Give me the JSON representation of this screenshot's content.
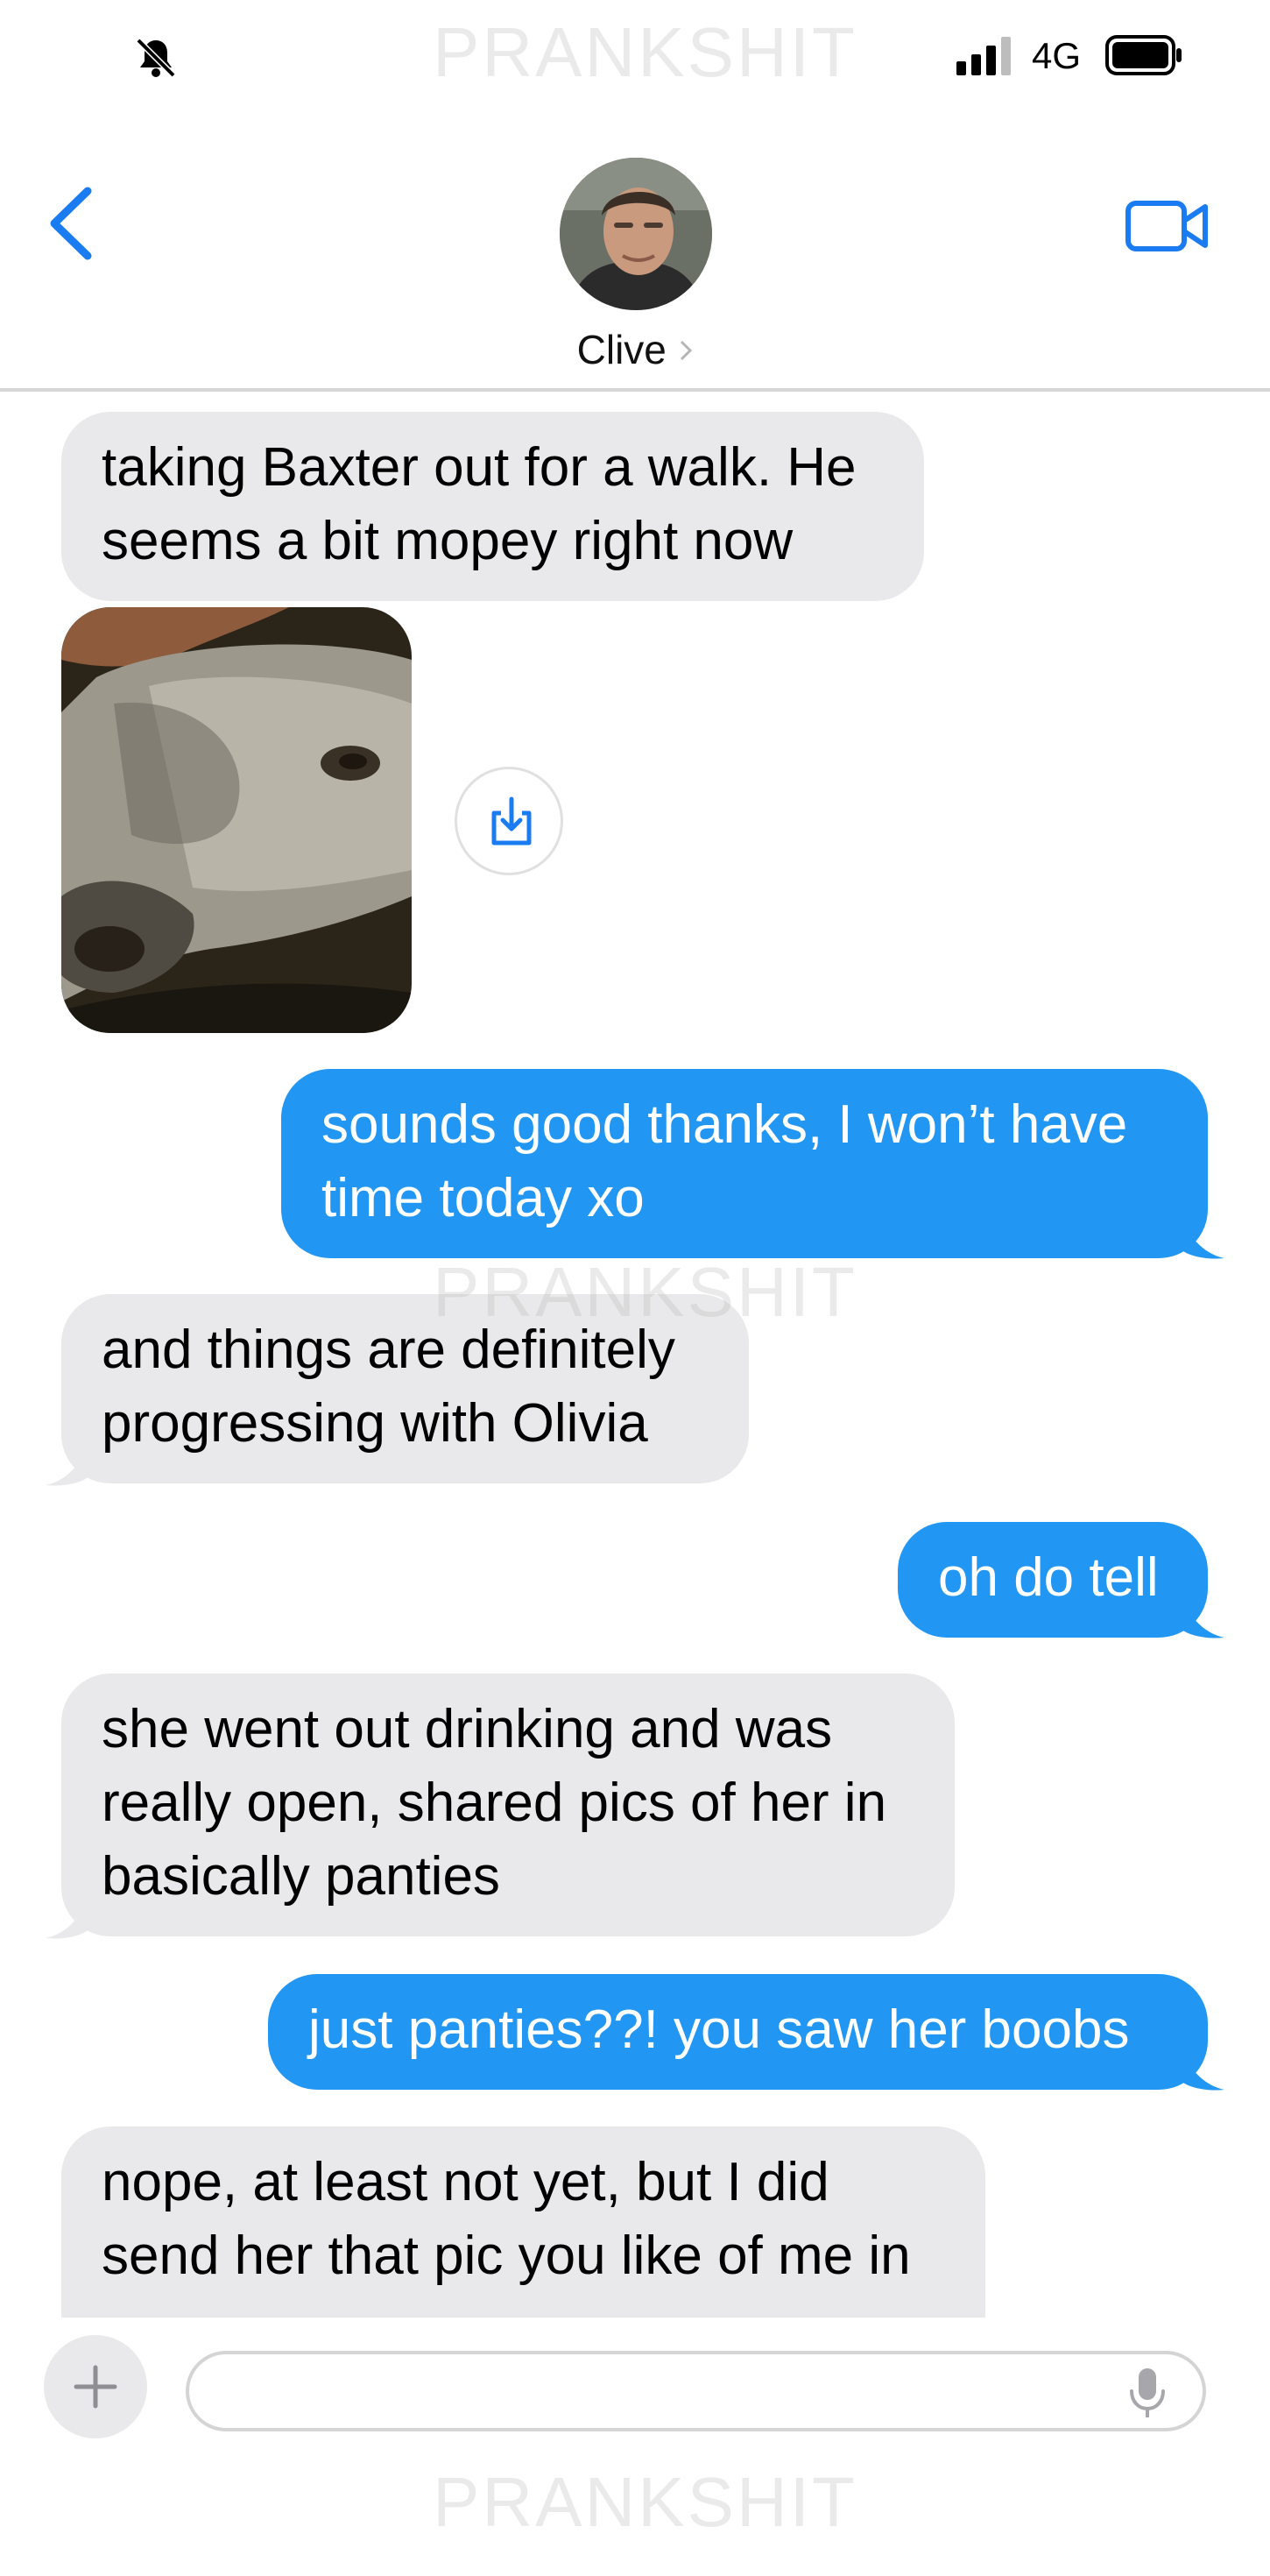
{
  "status_bar": {
    "network": "4G",
    "mute_icon": "bell-slash-icon",
    "signal_icon": "signal-bars-icon",
    "battery_icon": "battery-full-icon"
  },
  "watermark": "PRANKSHIT",
  "header": {
    "back_icon": "chevron-left-icon",
    "contact_name": "Clive",
    "video_icon": "video-camera-icon"
  },
  "messages": [
    {
      "from": "contact",
      "text": "taking Baxter out for a walk. He\nseems a bit mopey right now"
    },
    {
      "from": "contact",
      "type": "photo",
      "subject": "dog",
      "action_icon": "save-download-icon"
    },
    {
      "from": "me",
      "text": "sounds good thanks, I won’t have\ntime today xo"
    },
    {
      "from": "contact",
      "text": "and things are definitely\nprogressing with Olivia"
    },
    {
      "from": "me",
      "text": "oh do tell"
    },
    {
      "from": "contact",
      "text": "she went out drinking and was\nreally open, shared pics of her in\nbasically panties"
    },
    {
      "from": "me",
      "text": "just panties??! you saw her boobs"
    },
    {
      "from": "contact",
      "text": "nope, at least not yet, but I did\nsend her that pic you like of me in"
    }
  ],
  "composer": {
    "plus_icon": "plus-icon",
    "input_value": "",
    "mic_icon": "microphone-icon"
  },
  "colors": {
    "sent_bubble": "#2196f3",
    "received_bubble": "#e9e9eb",
    "accent": "#1a7cf0"
  }
}
